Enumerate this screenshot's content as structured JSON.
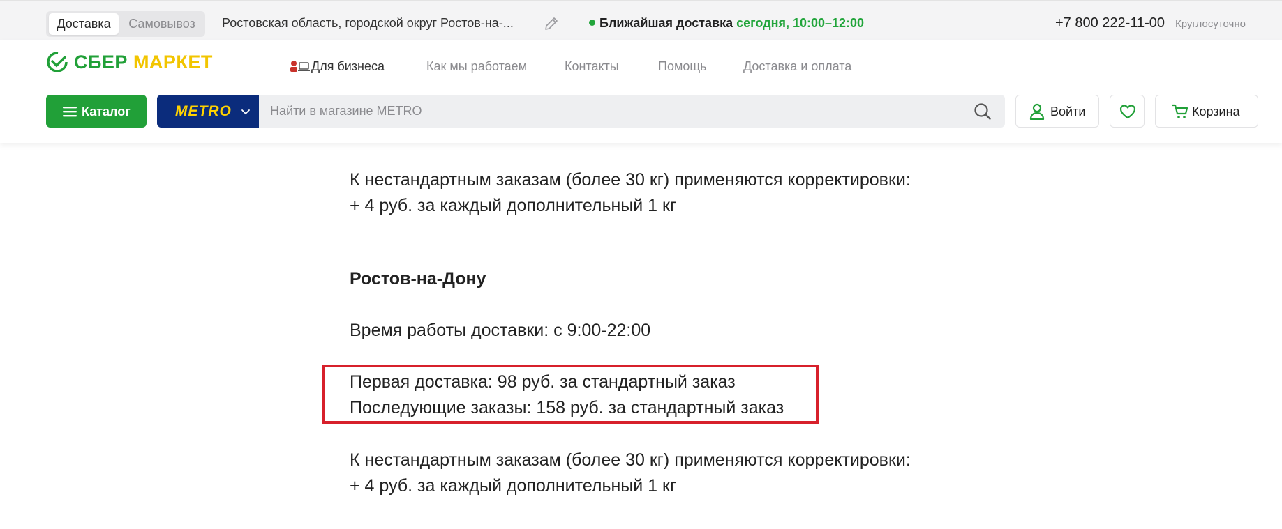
{
  "topbar": {
    "mode_active": "Доставка",
    "mode_passive": "Самовывоз",
    "address": "Ростовская область, городской округ Ростов-на-...",
    "delivery_label": "Ближайшая доставка",
    "delivery_time": "сегодня, 10:00–12:00",
    "phone": "+7 800 222-11-00",
    "hours": "Круглосуточно"
  },
  "header": {
    "logo_part1": "СБЕР",
    "logo_part2": "МАРКЕТ",
    "nav": [
      "Для бизнеса",
      "Как мы работаем",
      "Контакты",
      "Помощь",
      "Доставка и оплата"
    ],
    "catalog_label": "Каталог",
    "store_name": "METRO",
    "search_placeholder": "Найти в магазине METRO",
    "login_label": "Войти",
    "cart_label": "Корзина"
  },
  "content": {
    "adjust_top_1": "К нестандартным заказам (более 30 кг) применяются корректировки:",
    "adjust_top_2": "+ 4 руб. за каждый дополнительный 1 кг",
    "city_title": "Ростов-на-Дону",
    "work_hours": "Время работы доставки: с 9:00-22:00",
    "first_delivery": "Первая доставка: 98 руб. за стандартный заказ",
    "next_orders": "Последующие заказы: 158 руб. за стандартный заказ",
    "adjust_bottom_1": "К нестандартным заказам (более 30 кг) применяются корректировки:",
    "adjust_bottom_2": "+ 4 руб. за каждый дополнительный 1 кг"
  },
  "colors": {
    "brand_green": "#21a038",
    "brand_yellow": "#f2c500",
    "metro_blue": "#0b2c7c",
    "metro_yellow": "#ffd200",
    "highlight_red": "#d7202b"
  }
}
